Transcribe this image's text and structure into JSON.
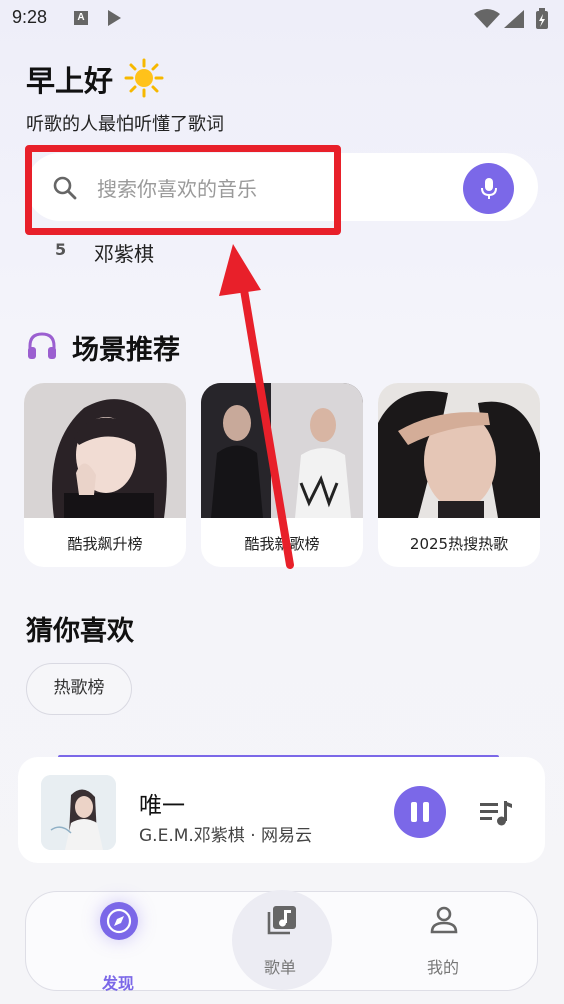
{
  "status_bar": {
    "time": "9:28",
    "notification_icons": [
      "a-icon",
      "play-icon"
    ],
    "system_icons": [
      "wifi-icon",
      "signal-icon",
      "battery-icon"
    ]
  },
  "header": {
    "greeting": "早上好",
    "greeting_icon": "sun-icon",
    "subtitle": "听歌的人最怕听懂了歌词"
  },
  "search": {
    "placeholder": "搜索你喜欢的音乐",
    "icon": "search-icon",
    "voice_icon": "mic-icon"
  },
  "hot_search": {
    "rank": "5",
    "name": "邓紫棋"
  },
  "scene_section": {
    "title": "场景推荐",
    "icon": "headphones-icon",
    "cards": [
      {
        "label": "酷我飙升榜"
      },
      {
        "label": "酷我新歌榜"
      },
      {
        "label": "2025热搜热歌"
      }
    ]
  },
  "guess_section": {
    "title": "猜你喜欢",
    "chips": [
      "热歌榜"
    ]
  },
  "player": {
    "title": "唯一",
    "artist": "G.E.M.邓紫棋 · 网易云",
    "state": "playing",
    "progress": 0.85
  },
  "tab_bar": {
    "tabs": [
      {
        "label": "发现",
        "icon": "compass-icon",
        "active": true
      },
      {
        "label": "歌单",
        "icon": "playlist-icon",
        "active": false
      },
      {
        "label": "我的",
        "icon": "user-icon",
        "active": false
      }
    ]
  },
  "colors": {
    "accent": "#7b68e8",
    "annotation": "#e8202a",
    "background": "#f4f4fa"
  }
}
